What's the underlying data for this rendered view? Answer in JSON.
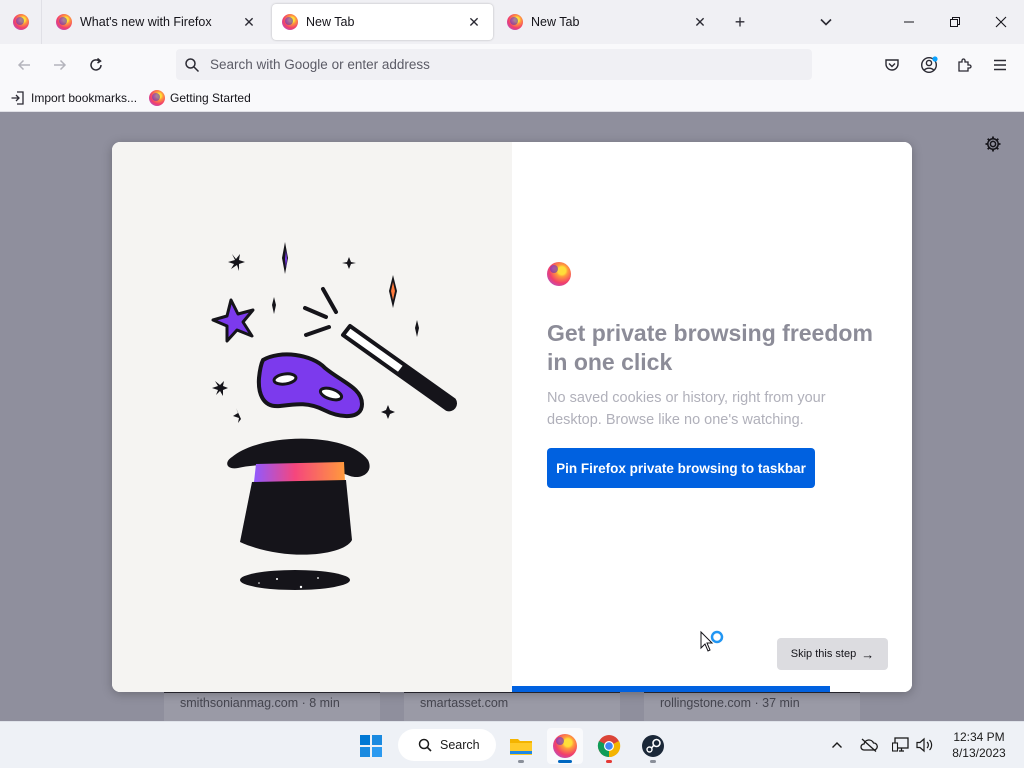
{
  "tabs": [
    {
      "title": "What's new with Firefox",
      "selected": false
    },
    {
      "title": "New Tab",
      "selected": true
    },
    {
      "title": "New Tab",
      "selected": false
    }
  ],
  "tab_close_glyph": "✕",
  "new_tab_glyph": "+",
  "list_tabs_icon": "chevron-down-icon",
  "window_controls": [
    "minimize-icon",
    "restore-icon",
    "close-icon"
  ],
  "navbar": {
    "search_placeholder": "Search with Google or enter address",
    "right_icons": [
      "pocket-icon",
      "account-icon",
      "extensions-icon",
      "hamburger-menu-icon"
    ]
  },
  "bookmarks": [
    {
      "label": "Import bookmarks...",
      "icon": "import-icon"
    },
    {
      "label": "Getting Started",
      "icon": "firefox-icon"
    }
  ],
  "background_cards": [
    {
      "text": "smithsonianmag.com · 8 min"
    },
    {
      "text": "smartasset.com"
    },
    {
      "text": "rollingstone.com · 37 min"
    }
  ],
  "modal": {
    "title": "Get private browsing freedom in one click",
    "subtitle": "No saved cookies or history, right from your desktop. Browse like no one's watching.",
    "primary_button": "Pin Firefox private browsing to taskbar",
    "skip_button": "Skip this step",
    "skip_arrow": "→"
  },
  "taskbar": {
    "search_label": "Search",
    "apps": [
      "file-explorer-icon",
      "firefox-icon",
      "chrome-icon",
      "steam-icon"
    ]
  },
  "clock": {
    "time": "12:34 PM",
    "date": "8/13/2023"
  },
  "colors": {
    "accent_blue": "#0061e0",
    "content_bg": "#8f8f9d",
    "illustration_purple": "#7c3aed",
    "tab_strip": "#f0f0f4"
  }
}
